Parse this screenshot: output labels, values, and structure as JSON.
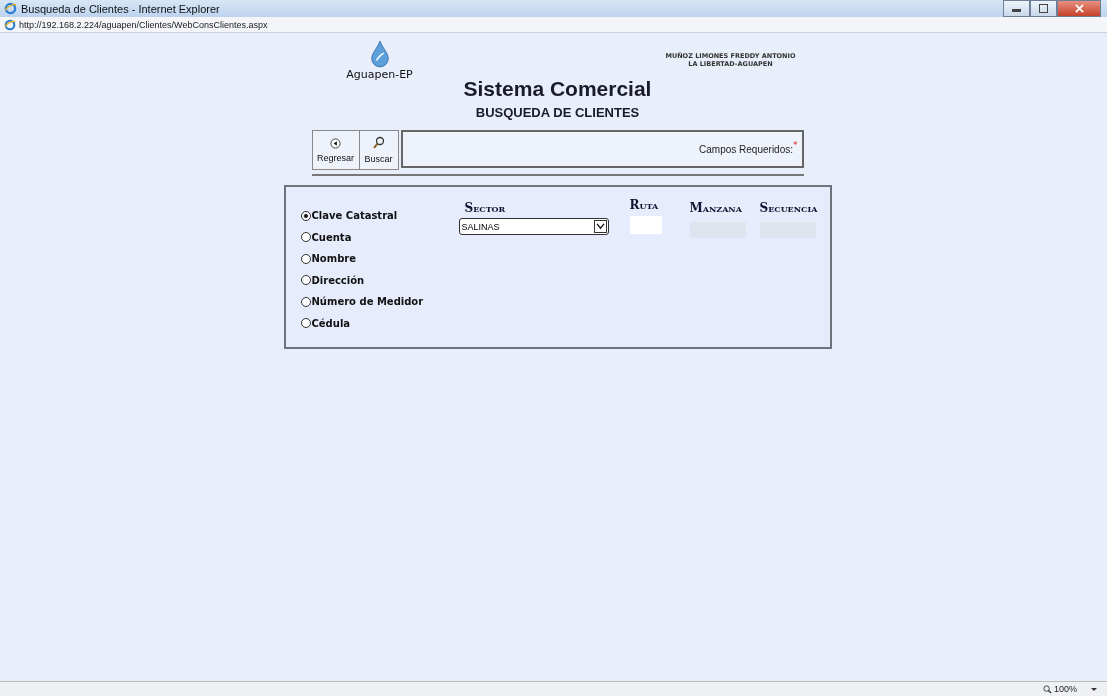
{
  "window": {
    "title": "Busqueda de Clientes - Internet Explorer",
    "address": "http://192.168.2.224/aguapen/Clientes/WebConsClientes.aspx"
  },
  "header": {
    "logo_text": "Aguapen-EP",
    "user_name": "MUÑOZ LIMONES FREDDY ANTONIO",
    "user_location": "LA LIBERTAD-AGUAPEN",
    "title": "Sistema Comercial",
    "subtitle": "BUSQUEDA DE CLIENTES"
  },
  "toolbar": {
    "buttons": [
      {
        "label": "Regresar",
        "kind": "back"
      },
      {
        "label": "Buscar",
        "kind": "search"
      }
    ],
    "required_label": "Campos Requeridos:",
    "required_mark": "*"
  },
  "search_options": [
    {
      "label": "Clave Catastral",
      "selected": true
    },
    {
      "label": "Cuenta",
      "selected": false
    },
    {
      "label": "Nombre",
      "selected": false
    },
    {
      "label": "Dirección",
      "selected": false
    },
    {
      "label": "Número de Medidor",
      "selected": false
    },
    {
      "label": "Cédula",
      "selected": false
    }
  ],
  "fields": [
    {
      "label": "Sector",
      "kind": "select",
      "value": "SALINAS"
    },
    {
      "label": "Ruta",
      "kind": "text",
      "disabled": false
    },
    {
      "label": "Manzana",
      "kind": "text",
      "disabled": true
    },
    {
      "label": "Secuencia",
      "kind": "text",
      "disabled": true
    }
  ],
  "status_bar": {
    "zoom": "100%"
  }
}
